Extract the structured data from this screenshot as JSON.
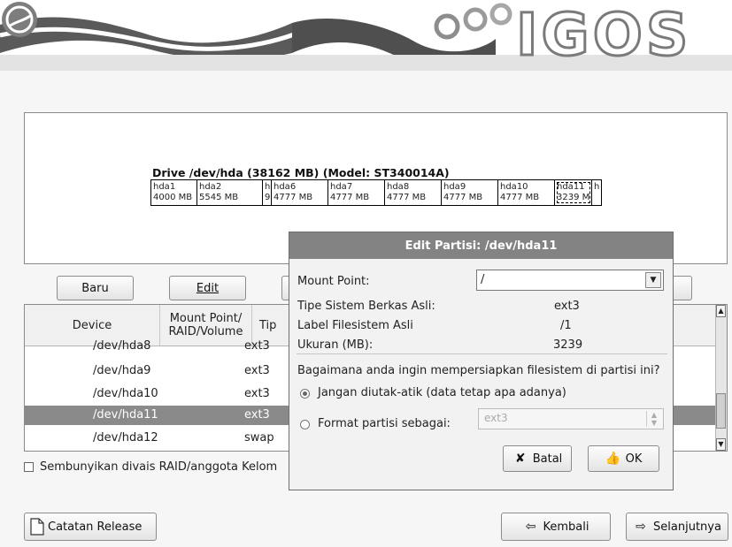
{
  "banner": {
    "logo_text": "IGOS",
    "emblem": "igos-emblem-icon"
  },
  "drive": {
    "title": "Drive /dev/hda (38162 MB) (Model: ST340014A)",
    "partitions": [
      {
        "name": "hda1",
        "size": "4000 MB"
      },
      {
        "name": "hda2",
        "size": "5545 MB"
      },
      {
        "name": "h",
        "size": "9"
      },
      {
        "name": "hda6",
        "size": "4777 MB"
      },
      {
        "name": "hda7",
        "size": "4777 MB"
      },
      {
        "name": "hda8",
        "size": "4777 MB"
      },
      {
        "name": "hda9",
        "size": "4777 MB"
      },
      {
        "name": "hda10",
        "size": "4777 MB"
      },
      {
        "name": "hda11",
        "size": "3239 M"
      },
      {
        "name": "h",
        "size": ""
      }
    ]
  },
  "buttons": {
    "baru": "Baru",
    "edit": "Edit"
  },
  "table": {
    "headers": [
      "Device",
      "Mount Point/ RAID/Volume",
      "Tip"
    ],
    "rows": [
      {
        "device": "/dev/hda8",
        "type": "ext3",
        "selected": false
      },
      {
        "device": "/dev/hda9",
        "type": "ext3",
        "selected": false
      },
      {
        "device": "/dev/hda10",
        "type": "ext3",
        "selected": false
      },
      {
        "device": "/dev/hda11",
        "type": "ext3",
        "selected": true
      },
      {
        "device": "/dev/hda12",
        "type": "swap",
        "selected": false
      }
    ]
  },
  "hide_raid": {
    "label": "Sembunyikan divais RAID/anggota Kelom"
  },
  "dialog": {
    "title": "Edit Partisi: /dev/hda11",
    "mount_point_label": "Mount Point:",
    "mount_point_value": "/",
    "fs_type_label": "Tipe Sistem Berkas Asli:",
    "fs_type_value": "ext3",
    "fs_label_label": "Label Filesistem Asli",
    "fs_label_value": "/1",
    "size_label": "Ukuran (MB):",
    "size_value": "3239",
    "question": "Bagaimana anda ingin mempersiapkan filesistem di partisi ini?",
    "option_keep": "Jangan diutak-atik (data tetap apa adanya)",
    "option_format": "Format partisi sebagai:",
    "format_value": "ext3",
    "cancel_label": "Batal",
    "ok_label": "OK"
  },
  "footer": {
    "release_notes": "Catatan Release",
    "back": "Kembali",
    "next": "Selanjutnya"
  },
  "colors": {
    "selection": "#8a8a8a",
    "dialog_title": "#838383"
  }
}
